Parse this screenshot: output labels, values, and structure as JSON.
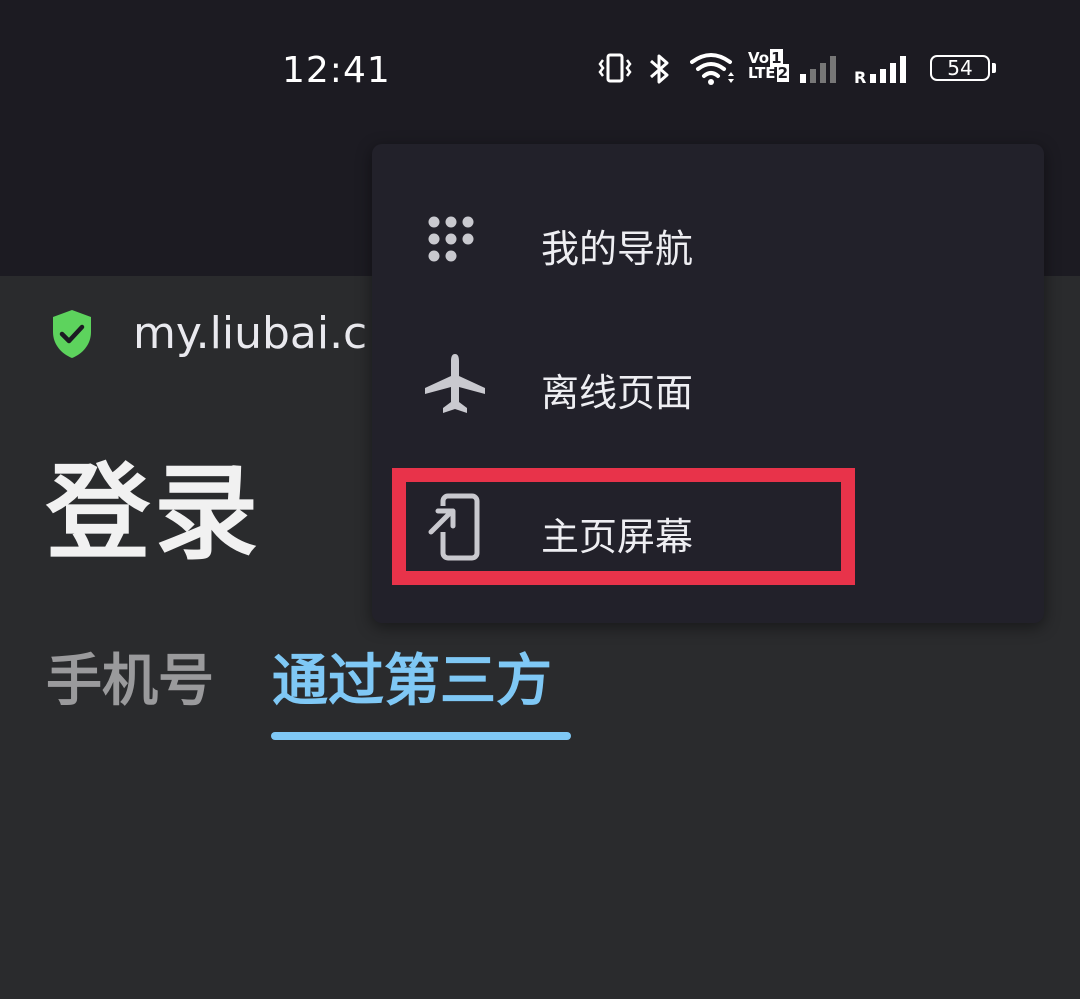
{
  "status_bar": {
    "time": "12:41",
    "volte_label_top": "Vo",
    "volte_label_bottom": "LTE",
    "sim1_badge": "1",
    "sim2_badge": "2",
    "roaming_label": "R",
    "battery": "54",
    "icons": [
      "vibrate-icon",
      "bluetooth-icon",
      "wifi-icon",
      "signal-icon",
      "battery-icon"
    ]
  },
  "url_bar": {
    "url": "my.liubai.c",
    "security_icon": "shield-check-icon",
    "security_color": "#5dd35d"
  },
  "page": {
    "title": "登录",
    "tabs": [
      {
        "label": "手机号",
        "active": false
      },
      {
        "label": "通过第三方",
        "active": true
      }
    ],
    "accent_color": "#7fc8f5"
  },
  "menu": {
    "items": [
      {
        "label": "我的导航",
        "icon": "apps-grid-icon"
      },
      {
        "label": "离线页面",
        "icon": "airplane-icon"
      },
      {
        "label": "主页屏幕",
        "icon": "add-to-home-screen-icon",
        "highlighted": true
      }
    ],
    "highlight_color": "#e8334a"
  }
}
